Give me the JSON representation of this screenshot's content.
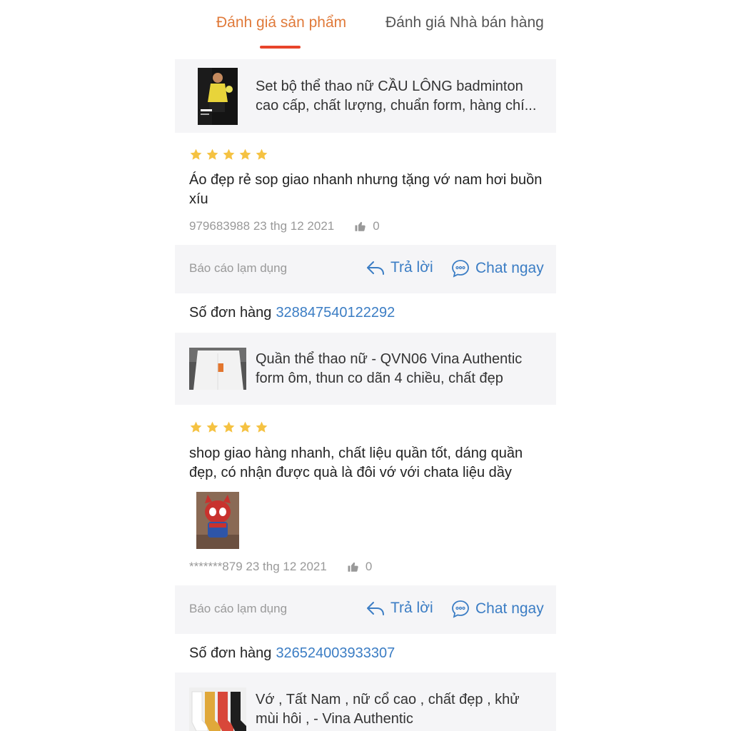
{
  "tabs": [
    {
      "label": "Đánh giá sản phẩm"
    },
    {
      "label": "Đánh giá Nhà bán hàng"
    }
  ],
  "reviews": [
    {
      "product_name": "Set bộ thể thao nữ CẦU LÔNG badminton cao cấp, chất lượng, chuẩn form, hàng chí...",
      "stars": 5,
      "text": "Áo đẹp rẻ sop giao nhanh nhưng tặng vớ nam hơi buồn xíu",
      "user_date": "979683988 23 thg 12 2021",
      "likes": "0",
      "report_label": "Báo cáo lạm dụng",
      "reply_label": "Trả lời",
      "chat_label": "Chat ngay"
    },
    {
      "order_label": "Số đơn hàng",
      "order_number": "328847540122292",
      "product_name": "Quần thể thao nữ - QVN06 Vina Authentic form ôm, thun co dãn 4 chiều, chất đẹp",
      "stars": 5,
      "text": "shop giao hàng nhanh, chất liệu quần tốt, dáng quần đẹp, có nhận được quà là đôi vớ với chata liệu dầy",
      "user_date": "*******879 23 thg 12 2021",
      "likes": "0",
      "report_label": "Báo cáo lạm dụng",
      "reply_label": "Trả lời",
      "chat_label": "Chat ngay"
    },
    {
      "order_label": "Số đơn hàng",
      "order_number": "326524003933307",
      "product_name": "Vớ , Tất Nam , nữ cổ cao , chất đẹp , khử mùi hôi , - Vina Authentic"
    }
  ],
  "colors": {
    "accent": "#e07a3a",
    "underline": "#e8442a",
    "link": "#3b7dc4",
    "star": "#f5c242",
    "panel": "#f5f5f7"
  }
}
